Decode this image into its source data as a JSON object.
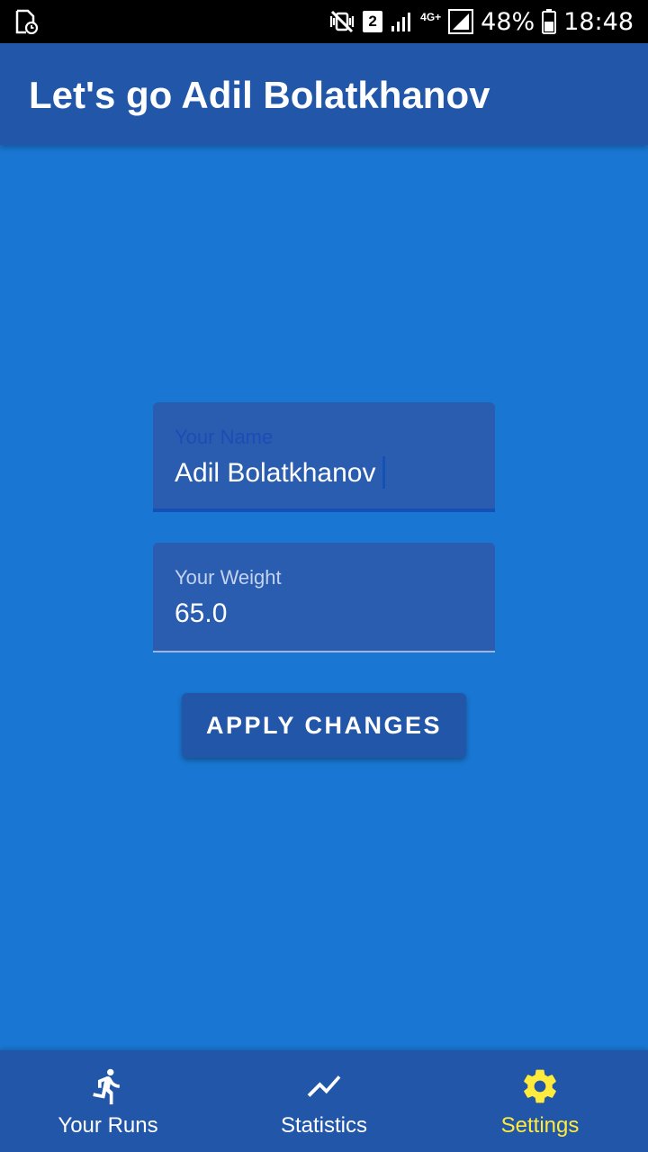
{
  "status_bar": {
    "left_icon": "screenshot-notification-icon",
    "mute_icon": "vibrate-mute-icon",
    "sim_badge": "2",
    "network_type": "4G+",
    "battery_percent": "48%",
    "time": "18:48"
  },
  "app_bar": {
    "title": "Let's go Adil Bolatkhanov"
  },
  "form": {
    "name_label": "Your Name",
    "name_value": "Adil Bolatkhanov",
    "weight_label": "Your Weight",
    "weight_value": "65.0",
    "apply_label": "APPLY CHANGES"
  },
  "bottom_nav": {
    "items": [
      {
        "label": "Your Runs",
        "icon": "running-person-icon",
        "active": false
      },
      {
        "label": "Statistics",
        "icon": "trending-line-icon",
        "active": false
      },
      {
        "label": "Settings",
        "icon": "gear-icon",
        "active": true
      }
    ]
  },
  "colors": {
    "background": "#1976D2",
    "primary": "#2256A8",
    "accent": "#FFEB3B"
  }
}
